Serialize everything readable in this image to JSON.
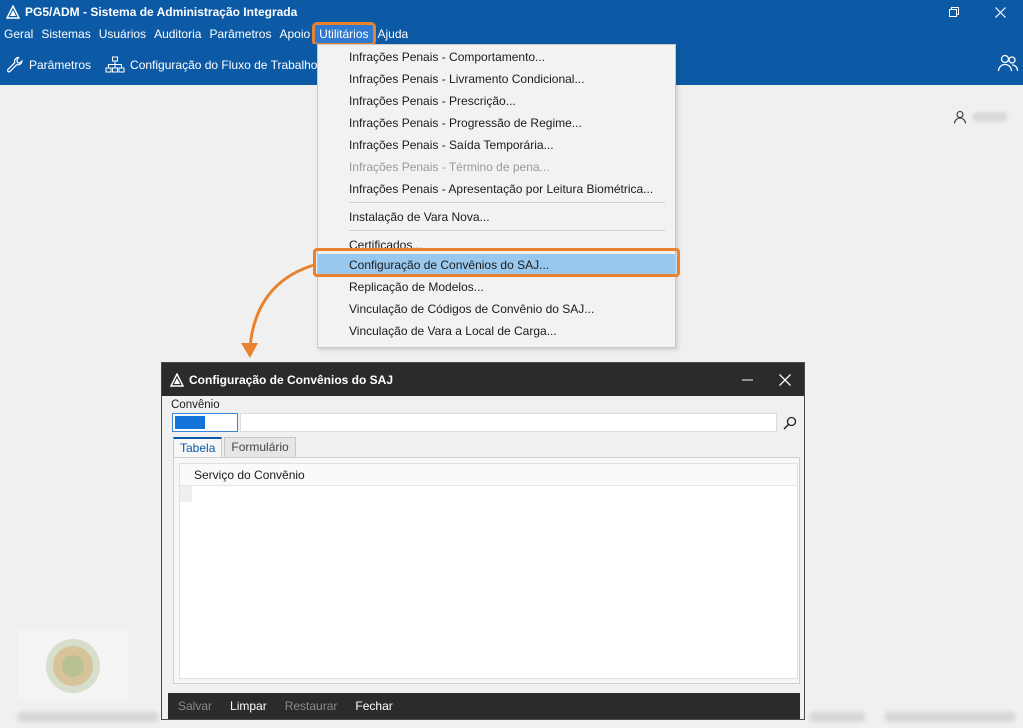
{
  "app": {
    "title": "PG5/ADM - Sistema de Administração Integrada"
  },
  "menubar": {
    "items": [
      {
        "label": "Geral"
      },
      {
        "label": "Sistemas"
      },
      {
        "label": "Usuários"
      },
      {
        "label": "Auditoria"
      },
      {
        "label": "Parâmetros"
      },
      {
        "label": "Apoio"
      },
      {
        "label": "Utilitários",
        "active": true
      },
      {
        "label": "Ajuda"
      }
    ]
  },
  "toolbar": {
    "params_label": "Parâmetros",
    "workflow_label": "Configuração do Fluxo de Trabalho"
  },
  "dropdown": {
    "items": [
      {
        "label": "Infrações Penais - Comportamento...",
        "enabled": true
      },
      {
        "label": "Infrações Penais - Livramento Condicional...",
        "enabled": true
      },
      {
        "label": "Infrações Penais - Prescrição...",
        "enabled": true
      },
      {
        "label": "Infrações Penais - Progressão de Regime...",
        "enabled": true
      },
      {
        "label": "Infrações Penais - Saída Temporária...",
        "enabled": true
      },
      {
        "label": "Infrações Penais - Término de pena...",
        "enabled": false
      },
      {
        "label": "Infrações Penais - Apresentação por Leitura Biométrica...",
        "enabled": true
      },
      {
        "label": "Instalação de Vara Nova...",
        "enabled": true
      },
      {
        "label": "Certificados...",
        "enabled": true
      },
      {
        "label": "Configuração de Convênios do SAJ...",
        "enabled": true,
        "selected": true
      },
      {
        "label": "Replicação de Modelos...",
        "enabled": true
      },
      {
        "label": "Vinculação de Códigos de Convênio do SAJ...",
        "enabled": true
      },
      {
        "label": "Vinculação de Vara a Local de Carga...",
        "enabled": true
      }
    ]
  },
  "dialog": {
    "title": "Configuração de Convênios do SAJ",
    "convenio_label": "Convênio",
    "tabs": [
      {
        "label": "Tabela",
        "active": true
      },
      {
        "label": "Formulário",
        "active": false
      }
    ],
    "grid_header": "Serviço do Convênio",
    "footer": {
      "save": "Salvar",
      "clear": "Limpar",
      "restore": "Restaurar",
      "close": "Fechar"
    }
  },
  "colors": {
    "brand_blue": "#0c5aa6",
    "highlight_orange": "#e8822e",
    "selection_blue": "#99c8ee",
    "dialog_dark": "#2b2b2b"
  }
}
